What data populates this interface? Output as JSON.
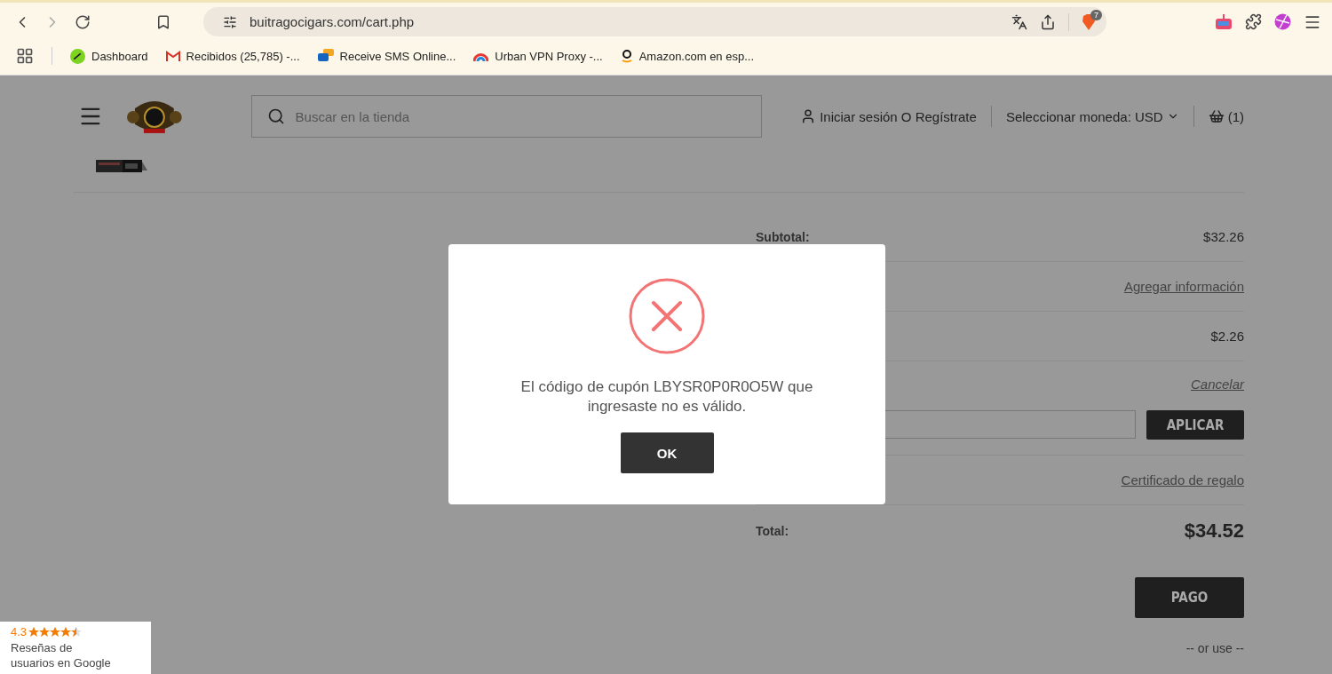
{
  "browser": {
    "url": "buitragocigars.com/cart.php",
    "shield_badge": "7",
    "bookmarks": [
      {
        "kind": "dashboard",
        "label": "Dashboard"
      },
      {
        "kind": "mail",
        "label": "Recibidos (25,785) -..."
      },
      {
        "kind": "sms",
        "label": "Receive SMS Online..."
      },
      {
        "kind": "vpn",
        "label": "Urban VPN Proxy -..."
      },
      {
        "kind": "amazon",
        "label": "Amazon.com en esp..."
      }
    ]
  },
  "header": {
    "search": {
      "placeholder": "Buscar en la tienda"
    },
    "account": "Iniciar sesión O Regístrate",
    "currency": "Seleccionar moneda: USD",
    "cart": "(1)"
  },
  "totals": [
    {
      "kind": "value",
      "label": "Subtotal:",
      "value": "$32.26"
    },
    {
      "kind": "link",
      "value": "Agregar información"
    },
    {
      "kind": "value",
      "value": "$2.26"
    },
    {
      "kind": "cancel",
      "value": "Cancelar"
    },
    {
      "kind": "coupon",
      "button": "APLICAR"
    },
    {
      "kind": "link",
      "value": "Certificado de regalo"
    },
    {
      "kind": "total",
      "label": "Total:",
      "value": "$34.52"
    }
  ],
  "checkout": {
    "button": "PAGO",
    "alt": "-- or use --"
  },
  "modal": {
    "message": "El código de cupón LBYSR0P0R0O5W que ingresaste no es válido.",
    "button": "OK"
  },
  "google_badge": {
    "rating": "4.3",
    "stars": 4.5,
    "caption": "Reseñas de usuarios en Google"
  }
}
